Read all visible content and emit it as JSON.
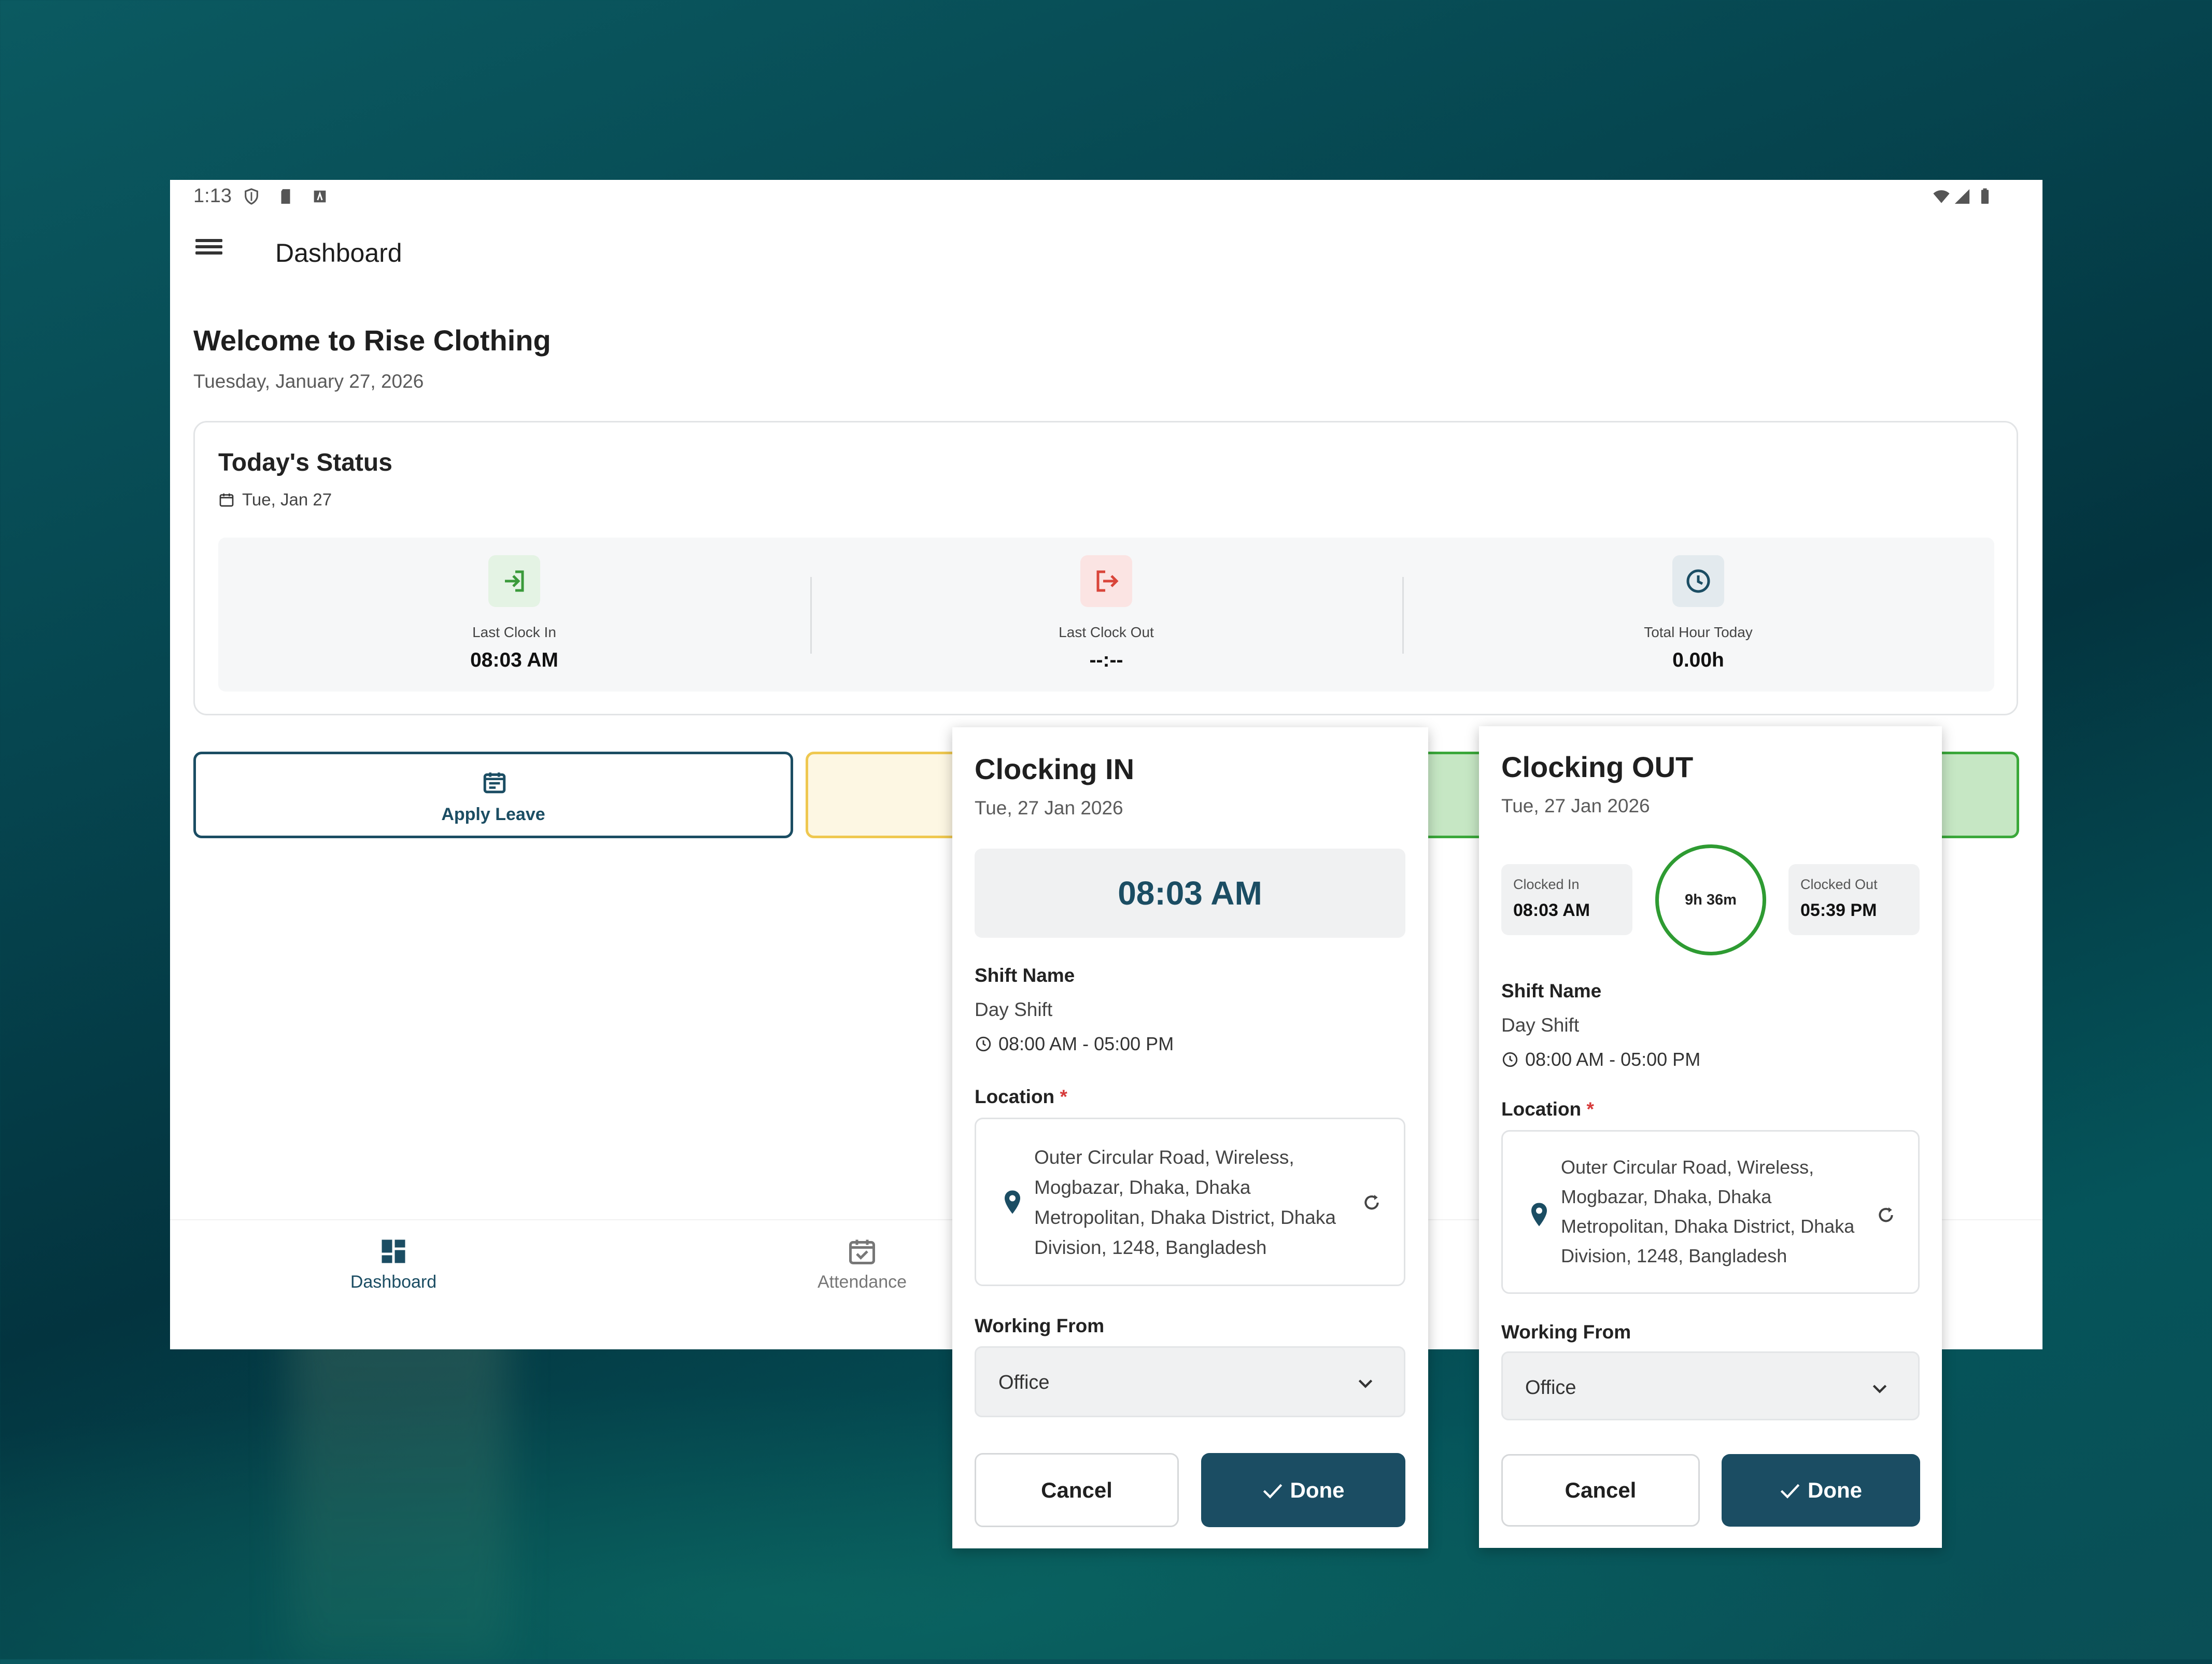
{
  "statusbar": {
    "time": "1:13"
  },
  "toolbar": {
    "title": "Dashboard"
  },
  "welcome": {
    "heading": "Welcome to Rise Clothing",
    "date": "Tuesday, January 27, 2026"
  },
  "status_card": {
    "title": "Today's Status",
    "date": "Tue, Jan 27",
    "stats": [
      {
        "label": "Last Clock In",
        "value": "08:03 AM",
        "color": "#3a9a3a"
      },
      {
        "label": "Last Clock Out",
        "value": "--:--",
        "color": "#d9453a"
      },
      {
        "label": "Total Hour Today",
        "value": "0.00h",
        "color": "#1b4d63"
      }
    ]
  },
  "actions": {
    "apply_leave": "Apply Leave"
  },
  "bottom_nav": {
    "dashboard": "Dashboard",
    "attendance": "Attendance"
  },
  "clock_in_dialog": {
    "title": "Clocking IN",
    "date": "Tue, 27 Jan 2026",
    "time": "08:03 AM",
    "shift_label": "Shift Name",
    "shift_name": "Day Shift",
    "shift_time": "08:00 AM - 05:00 PM",
    "location_label": "Location",
    "required_mark": "*",
    "address": "Outer Circular Road, Wireless, Mogbazar, Dhaka, Dhaka Metropolitan, Dhaka District, Dhaka Division, 1248, Bangladesh",
    "working_from_label": "Working From",
    "working_from_value": "Office",
    "cancel_label": "Cancel",
    "done_label": "Done"
  },
  "clock_out_dialog": {
    "title": "Clocking OUT",
    "date": "Tue, 27 Jan 2026",
    "clocked_in_label": "Clocked In",
    "clocked_in_value": "08:03 AM",
    "duration": "9h 36m",
    "clocked_out_label": "Clocked Out",
    "clocked_out_value": "05:39 PM",
    "shift_label": "Shift Name",
    "shift_name": "Day Shift",
    "shift_time": "08:00 AM - 05:00 PM",
    "location_label": "Location",
    "required_mark": "*",
    "address": "Outer Circular Road, Wireless, Mogbazar, Dhaka, Dhaka Metropolitan, Dhaka District, Dhaka Division, 1248, Bangladesh",
    "working_from_label": "Working From",
    "working_from_value": "Office",
    "cancel_label": "Cancel",
    "done_label": "Done"
  },
  "colors": {
    "primary": "#1b4d63",
    "success": "#2e9b32",
    "danger": "#d9453a",
    "warning": "#efc850"
  }
}
